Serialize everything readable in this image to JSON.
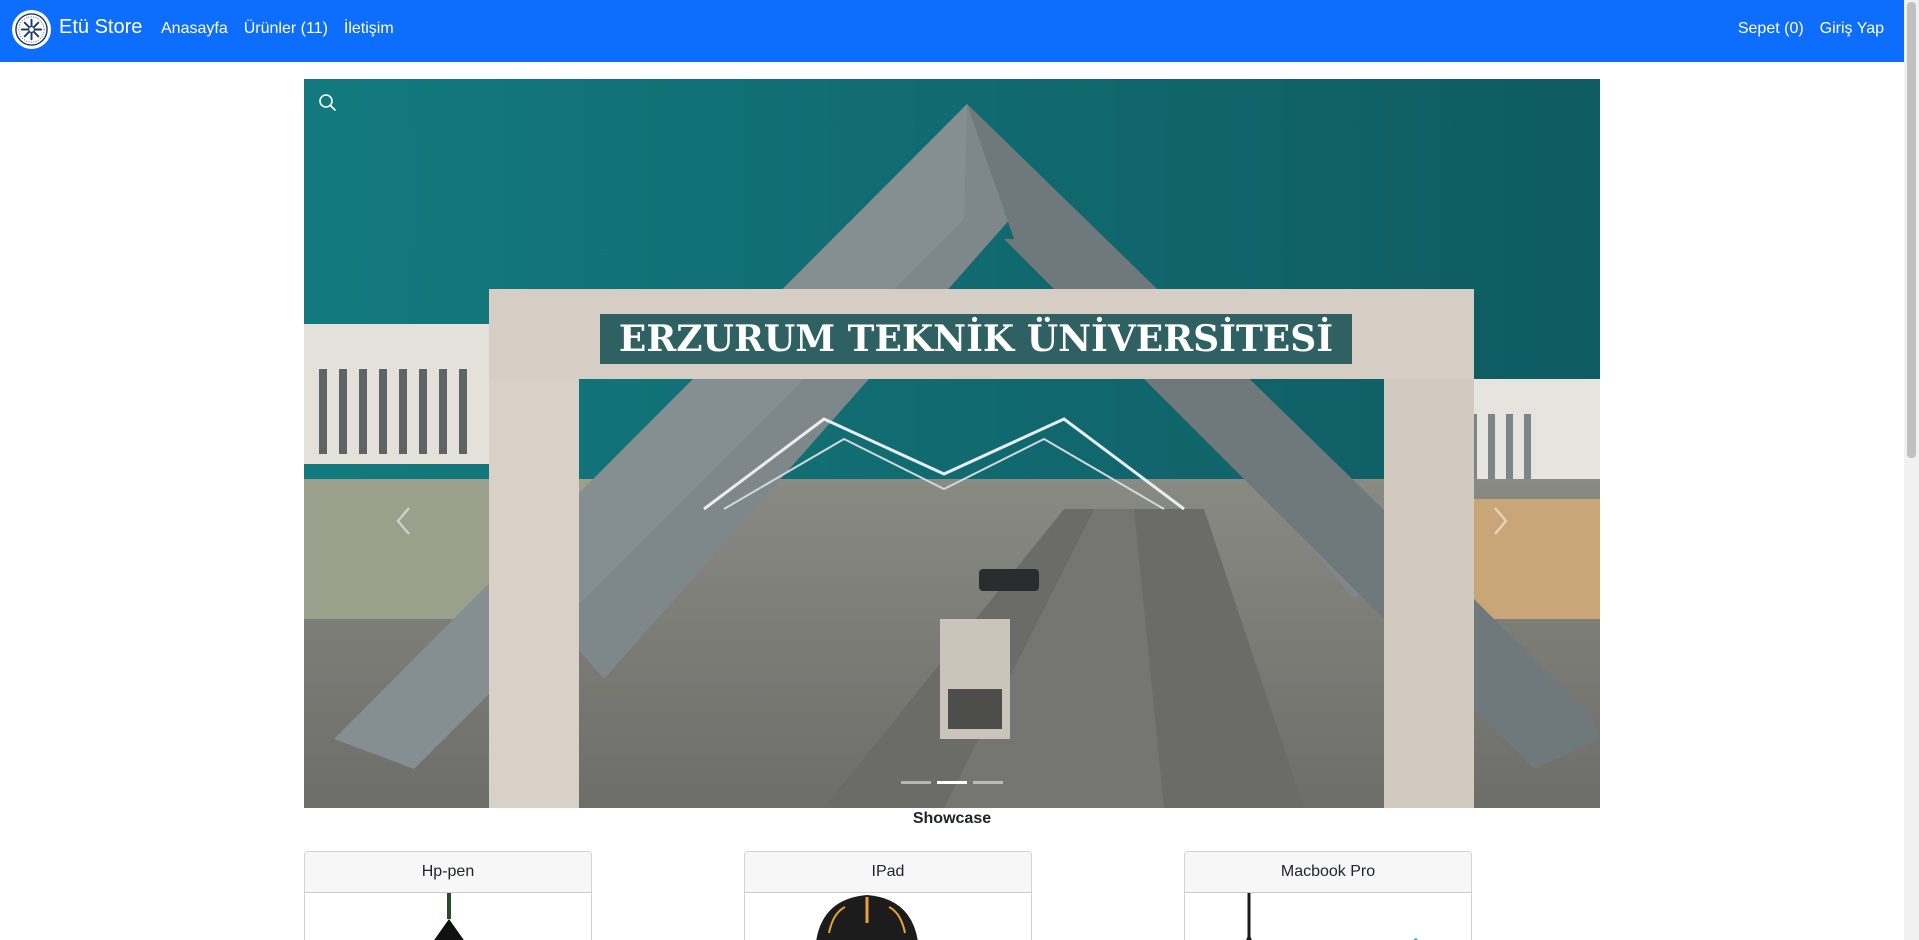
{
  "navbar": {
    "brand": "Etü Store",
    "links": [
      "Anasayfa",
      "Ürünler (11)",
      "İletişim"
    ],
    "right_links": [
      "Sepet (0)",
      "Giriş Yap"
    ],
    "bg_color": "#0d6efd"
  },
  "carousel": {
    "banner_text": "ERZURUM TEKNİK ÜNİVERSİTESİ",
    "indicators": 3,
    "active_indicator": 1
  },
  "showcase": {
    "label": "Showcase"
  },
  "products": [
    {
      "name": "Hp-pen"
    },
    {
      "name": "IPad"
    },
    {
      "name": "Macbook Pro"
    }
  ]
}
